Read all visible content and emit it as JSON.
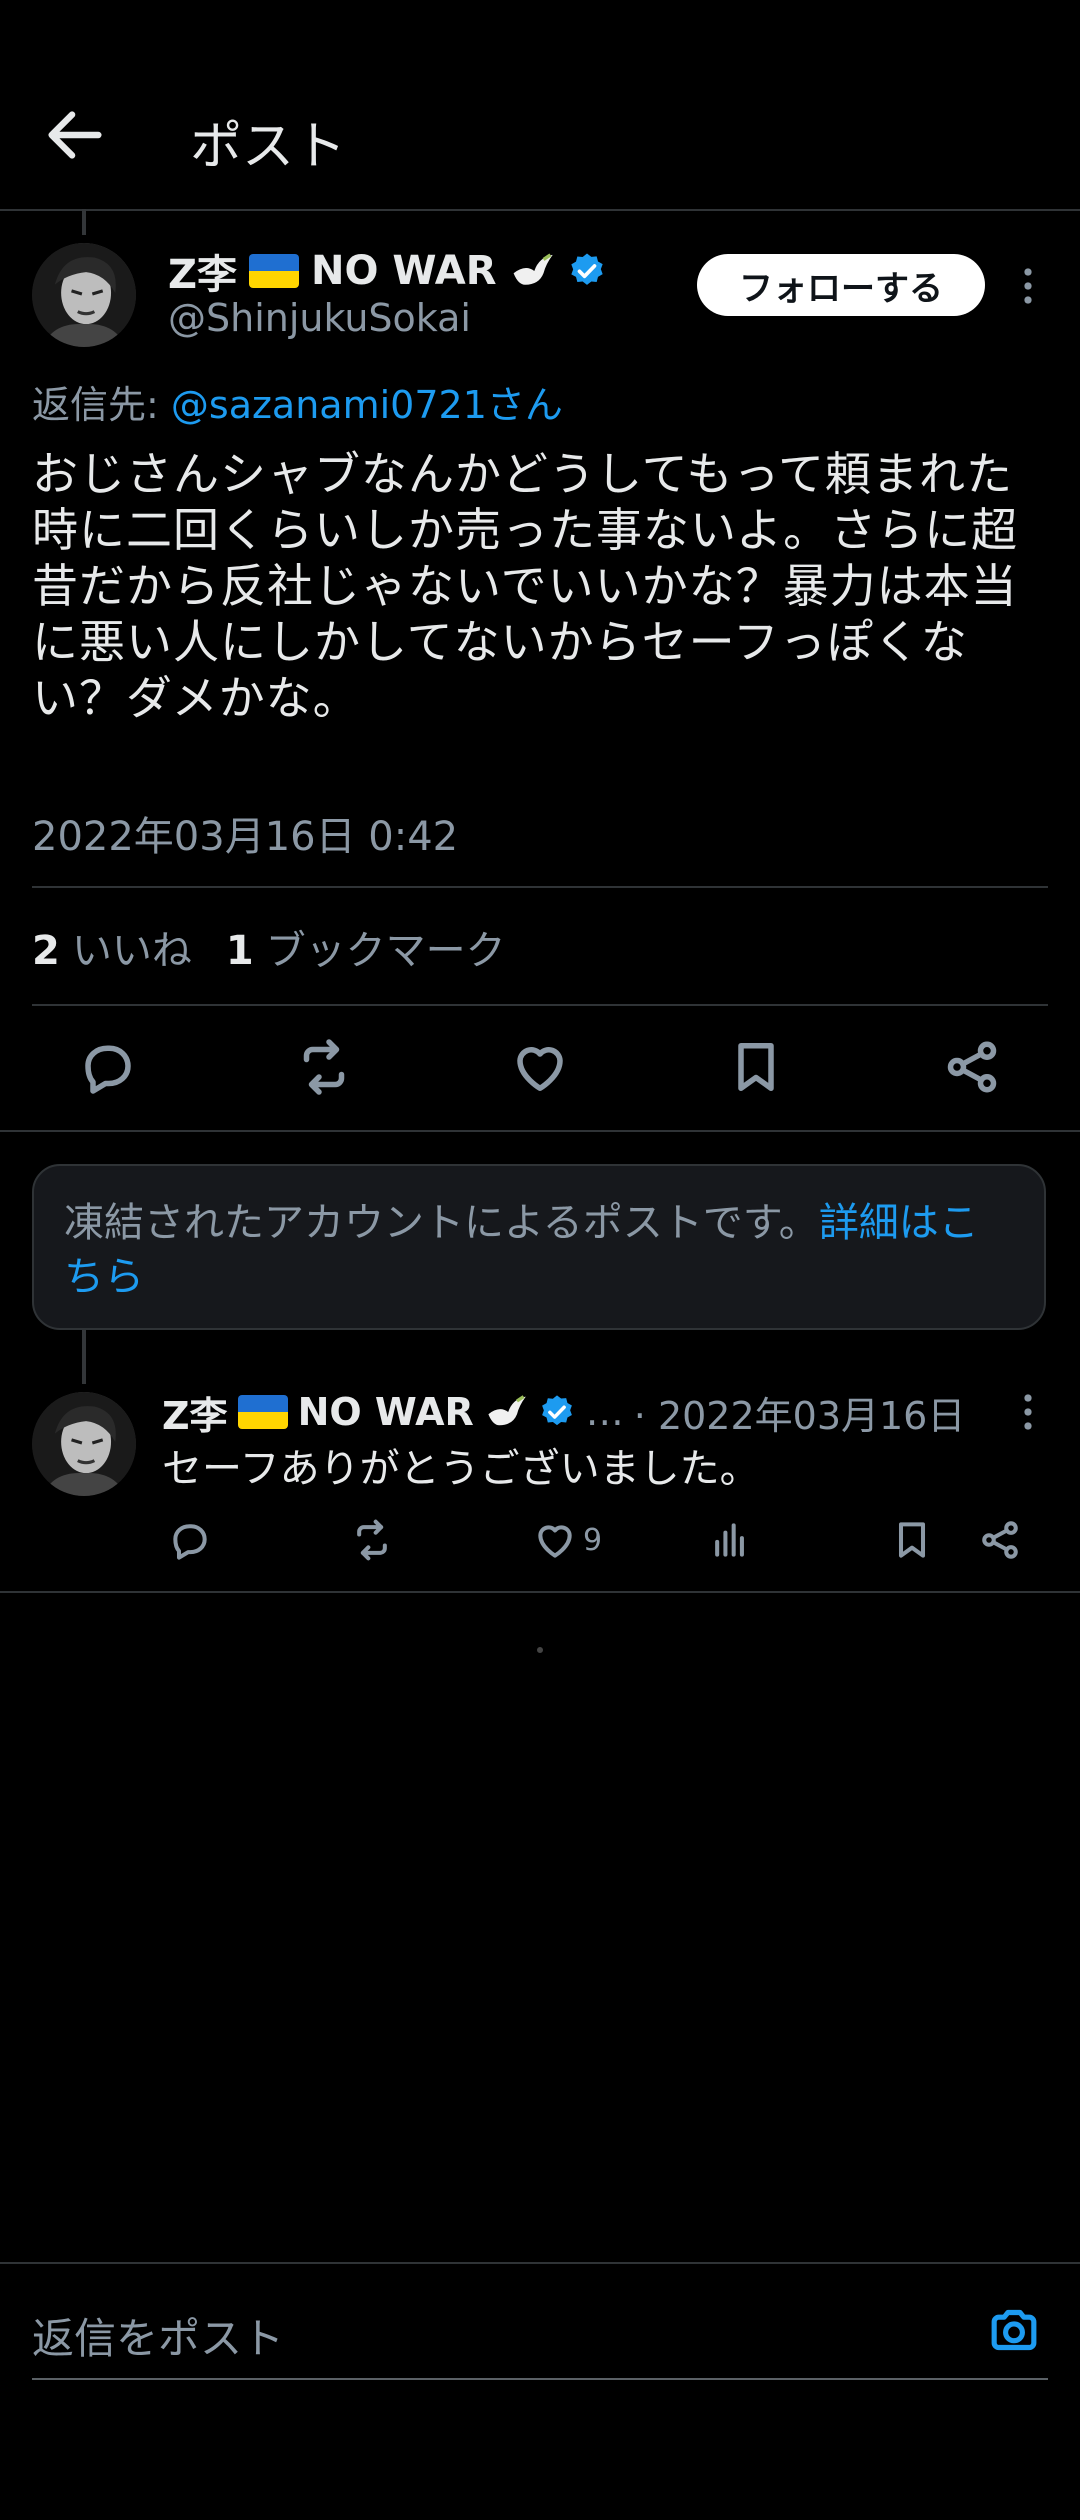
{
  "header": {
    "title": "ポスト"
  },
  "post": {
    "author_name": "Z李",
    "author_name_suffix": "NO WAR",
    "handle": "@ShinjukuSokai",
    "follow_label": "フォローする",
    "reply_prefix": "返信先:",
    "reply_to": "@sazanami0721さん",
    "text": "おじさんシャブなんかどうしてもって頼まれた時に二回くらいしか売った事ないよ。さらに超昔だから反社じゃないでいいかな？暴力は本当に悪い人にしかしてないからセーフっぽくない？ダメかな。",
    "timestamp": "2022年03月16日 0:42",
    "likes_count": "2",
    "likes_label": "いいね",
    "bookmarks_count": "1",
    "bookmarks_label": "ブックマーク"
  },
  "notice": {
    "text": "凍結されたアカウントによるポストです。",
    "link": "詳細はこちら"
  },
  "reply": {
    "author_name": "Z李",
    "author_name_suffix": "NO WAR",
    "ellipsis": "…",
    "date": "· 2022年03月16日",
    "text": "セーフありがとうございました。",
    "likes": "9"
  },
  "composer": {
    "placeholder": "返信をポスト"
  },
  "colors": {
    "accent": "#1d9bf0",
    "background": "#000000",
    "muted": "#8b98a5"
  },
  "icons": [
    "back-arrow-icon",
    "verified-badge-icon",
    "dove-icon",
    "reply-icon",
    "repost-icon",
    "like-icon",
    "bookmark-icon",
    "share-icon",
    "views-icon",
    "more-icon",
    "camera-icon"
  ]
}
